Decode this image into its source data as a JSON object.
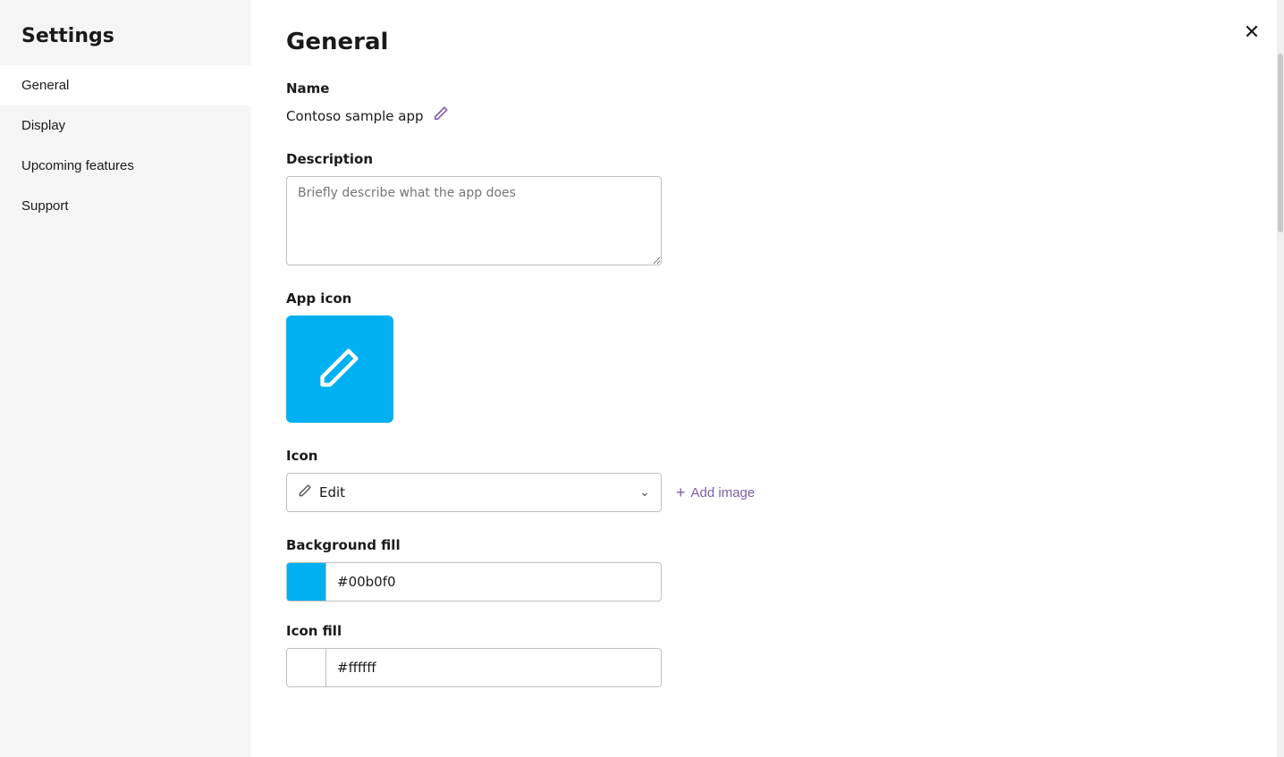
{
  "sidebar": {
    "title": "Settings",
    "items": [
      {
        "id": "general",
        "label": "General",
        "active": true
      },
      {
        "id": "display",
        "label": "Display",
        "active": false
      },
      {
        "id": "upcoming-features",
        "label": "Upcoming features",
        "active": false
      },
      {
        "id": "support",
        "label": "Support",
        "active": false
      }
    ]
  },
  "main": {
    "page_title": "General",
    "close_label": "×",
    "name_section": {
      "label": "Name",
      "value": "Contoso sample app"
    },
    "description_section": {
      "label": "Description",
      "placeholder": "Briefly describe what the app does"
    },
    "app_icon_section": {
      "label": "App icon",
      "background_color": "#00b0f0"
    },
    "icon_section": {
      "label": "Icon",
      "select_value": "Edit",
      "add_image_label": "Add image"
    },
    "background_fill_section": {
      "label": "Background fill",
      "color": "#00b0f0",
      "color_value": "#00b0f0"
    },
    "icon_fill_section": {
      "label": "Icon fill",
      "color": "#ffffff",
      "color_value": "#ffffff"
    }
  }
}
